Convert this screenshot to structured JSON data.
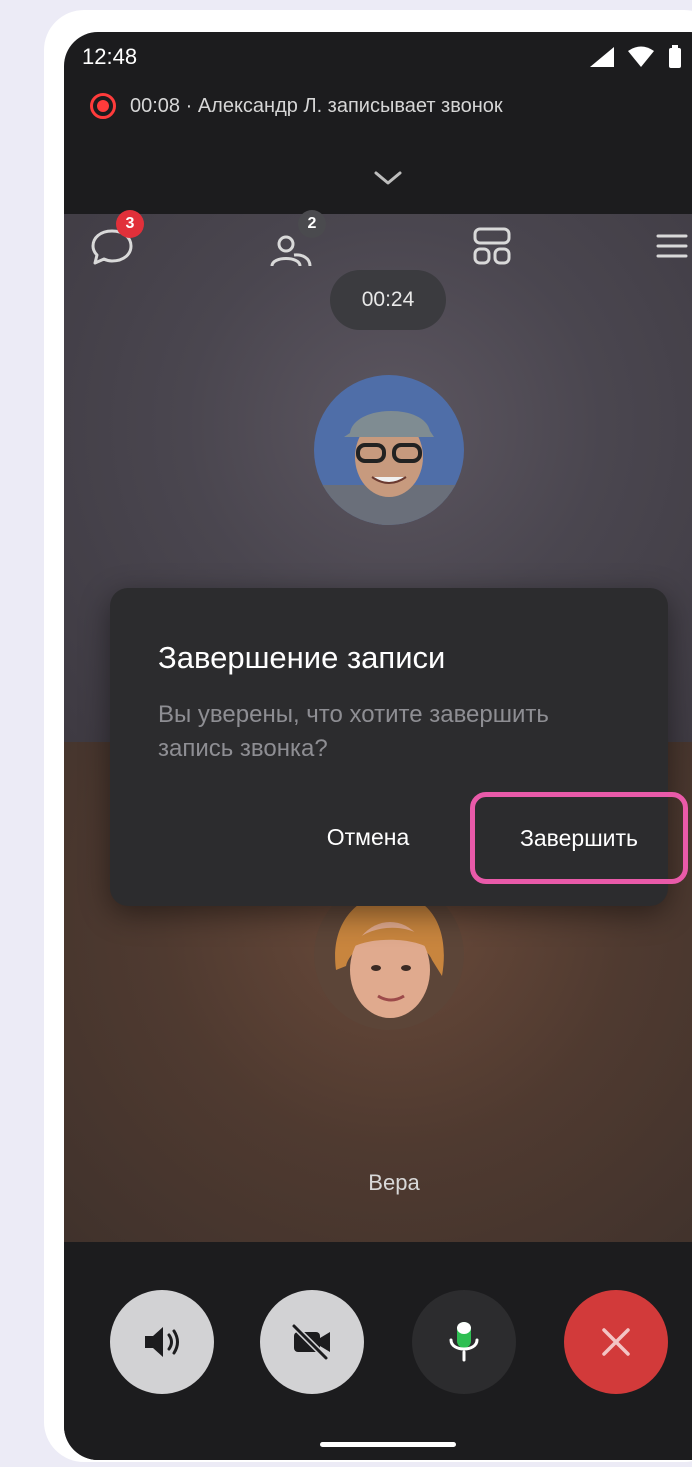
{
  "status_bar": {
    "time": "12:48",
    "icons": [
      "cellular-signal-icon",
      "wifi-icon",
      "battery-icon"
    ]
  },
  "recording_banner": {
    "text": "00:08 · Александр Л. записывает звонок",
    "icon": "recording-icon",
    "color": "#ff3b3b"
  },
  "toolbar": {
    "chat": {
      "icon": "chat-icon",
      "badge": "3",
      "badge_color": "#e1303a"
    },
    "participants": {
      "icon": "participants-icon",
      "badge": "2",
      "badge_color": "#4a4a4e"
    },
    "layout": {
      "icon": "layout-grid-icon"
    },
    "menu": {
      "icon": "menu-icon"
    }
  },
  "call": {
    "timer": "00:24",
    "participant_name": "Вера"
  },
  "dialog": {
    "title": "Завершение записи",
    "body": "Вы уверены, что хотите завершить запись звонка?",
    "cancel_label": "Отмена",
    "confirm_label": "Завершить",
    "highlight_color": "#e95aa9"
  },
  "controls": {
    "speaker": {
      "icon": "speaker-icon"
    },
    "camera": {
      "icon": "camera-off-icon"
    },
    "mic": {
      "icon": "microphone-icon",
      "accent": "#2fbf53"
    },
    "hangup": {
      "icon": "close-icon",
      "color": "#d23a3a"
    }
  }
}
